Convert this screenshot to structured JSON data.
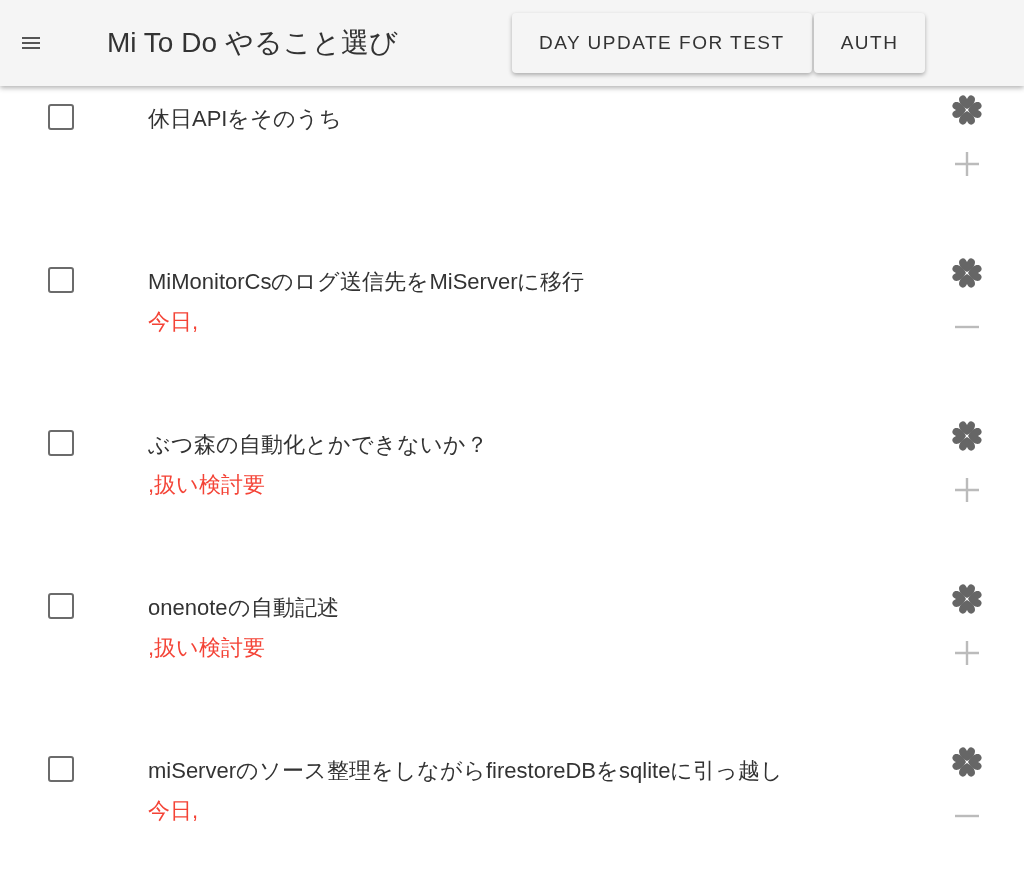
{
  "app_bar": {
    "title": "Mi To Do やること選び",
    "buttons": [
      "DAY UPDATE FOR TEST",
      "AUTH"
    ]
  },
  "items": [
    {
      "title": "休日APIをそのうち",
      "checked": false,
      "expanded": false
    },
    {
      "title": "MiMonitorCsのログ送信先をMiServerに移行",
      "note": "今日,",
      "checked": false,
      "expanded": true
    },
    {
      "title": "ぶつ森の自動化とかできないか？",
      "note": ",扱い検討要",
      "checked": false,
      "expanded": false
    },
    {
      "title": "onenoteの自動記述",
      "note": ",扱い検討要",
      "checked": false,
      "expanded": false
    },
    {
      "title": "miServerのソース整理をしながらfirestoreDBをsqliteに引っ越し",
      "note": "今日,",
      "checked": false,
      "expanded": true
    }
  ]
}
